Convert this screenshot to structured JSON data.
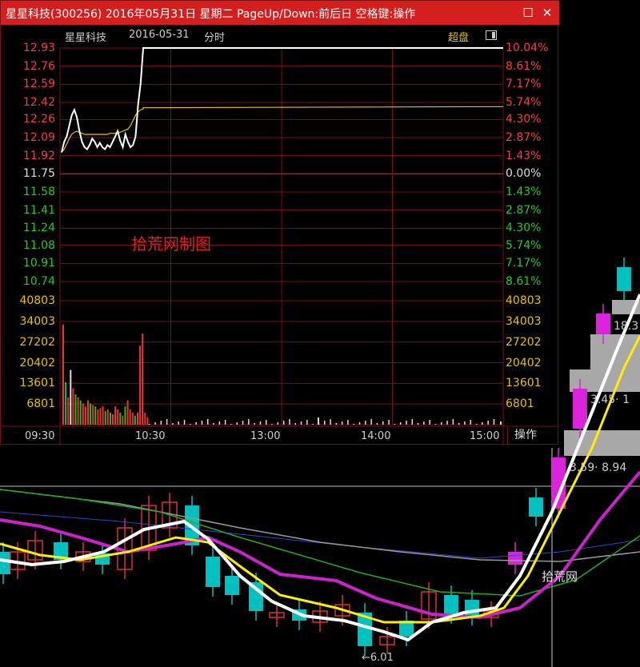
{
  "window": {
    "title": "星星科技(300256) 2016年05月31日 星期二 PageUp/Down:前后日 空格键:操作",
    "restore_glyph": "☐",
    "close_glyph": "✕"
  },
  "header": {
    "stock_name": "星星科技",
    "date": "2016-05-31",
    "chart_mode": "分时",
    "superposition_label": "超盘"
  },
  "price_axis": {
    "left": [
      "12.93",
      "12.76",
      "12.59",
      "12.42",
      "12.26",
      "12.09",
      "11.92",
      "11.75",
      "11.58",
      "11.41",
      "11.24",
      "11.08",
      "10.91",
      "10.74"
    ],
    "right": [
      "10.04%",
      "8.61%",
      "7.17%",
      "5.74%",
      "4.30%",
      "2.87%",
      "1.43%",
      "0.00%",
      "1.43%",
      "2.87%",
      "4.30%",
      "5.74%",
      "7.17%",
      "8.61%"
    ]
  },
  "volume_axis": {
    "left": [
      "40803",
      "34003",
      "27202",
      "20402",
      "13601",
      "6801"
    ],
    "right": [
      "40803",
      "34003",
      "27202",
      "20402",
      "13601",
      "6801"
    ]
  },
  "time_axis": [
    "09:30",
    "10:30",
    "13:00",
    "14:00",
    "15:00"
  ],
  "operation_label": "操作",
  "watermark": "拾荒网制图",
  "background_chart": {
    "watermark": "拾荒网",
    "low_label": "←6.01",
    "label_a": "18.3",
    "label_b": "3.45· 1",
    "label_c": "3.59· 8.94"
  },
  "colors": {
    "title_bar": "#d51f1f",
    "grid": "#7a1010",
    "up": "#e03030",
    "down": "#00c0c0",
    "price_line": "#ffffff",
    "avg_line": "#e8c100",
    "ma_yellow": "#ffee00",
    "ma_magenta": "#cc22cc",
    "vol_up": "#ee3333",
    "vol_down": "#22bb22"
  },
  "chart_data": {
    "type": "line",
    "title": "星星科技 2016-05-31 分时",
    "ylim": [
      10.74,
      12.93
    ],
    "x_labels": [
      "09:30",
      "10:30",
      "13:00",
      "14:00",
      "15:00"
    ],
    "series": [
      {
        "values": [
          11.95,
          12.05,
          12.1,
          12.2,
          12.3,
          12.35,
          12.28,
          12.15,
          12.05,
          12.0,
          11.98,
          12.02,
          12.08,
          12.05,
          12.0,
          12.04,
          12.0,
          11.98,
          12.02,
          12.0,
          12.05,
          12.1,
          12.15,
          12.06,
          12.0,
          12.12,
          12.05,
          12.0,
          12.02,
          12.1,
          12.4,
          12.6,
          12.93,
          12.93,
          12.93
        ]
      },
      {
        "values": [
          11.95,
          11.98,
          12.03,
          12.08,
          12.12,
          12.14,
          12.15,
          12.14,
          12.13,
          12.12,
          12.12,
          12.12,
          12.12,
          12.12,
          12.12,
          12.12,
          12.12,
          12.12,
          12.12,
          12.13,
          12.13,
          12.13,
          12.14,
          12.14,
          12.15,
          12.16,
          12.17,
          12.2,
          12.25,
          12.3,
          12.33,
          12.35,
          12.36,
          12.37,
          12.38
        ]
      }
    ],
    "volume": {
      "ylim": [
        0,
        40803
      ],
      "values": [
        33000,
        14000,
        9000,
        18000,
        12000,
        10000,
        9000,
        8000,
        7000,
        6000,
        8000,
        7000,
        6500,
        6000,
        5000,
        5500,
        6000,
        4500,
        5000,
        4000,
        3500,
        6000,
        5000,
        4000,
        3000,
        6000,
        8000,
        5000,
        4000,
        3000,
        4000,
        26000,
        30000,
        4000,
        2500
      ]
    }
  }
}
